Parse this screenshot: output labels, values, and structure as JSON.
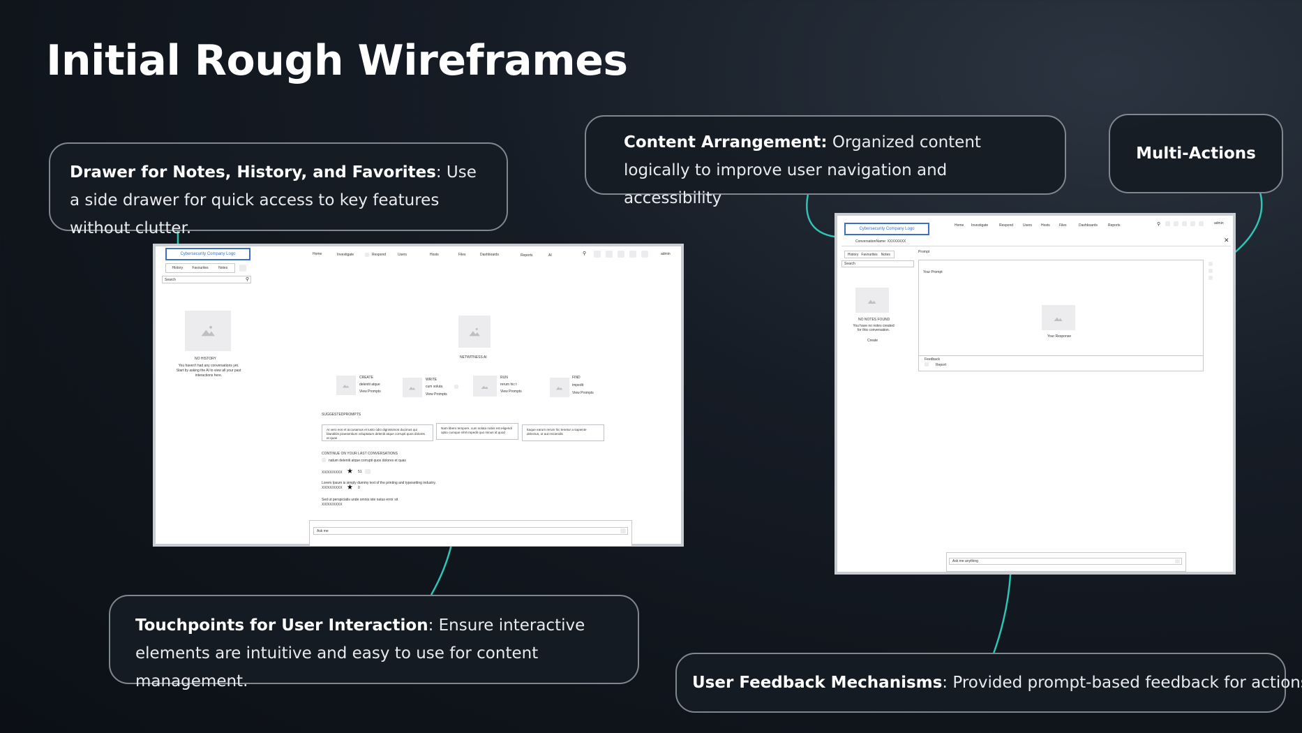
{
  "title": "Initial Rough Wireframes",
  "callouts": {
    "drawer": {
      "bold": "Drawer for Notes, History, and Favorites",
      "text": ": Use a side drawer for quick access to key features without clutter."
    },
    "content": {
      "bold": "Content Arrangement:",
      "text": " Organized content logically to improve user navigation and accessibility"
    },
    "multi": {
      "bold": "Multi-Actions"
    },
    "touch": {
      "bold": "Touchpoints for User Interaction",
      "text": ": Ensure interactive elements are intuitive and easy to use for content management."
    },
    "feedback": {
      "bold": "User Feedback Mechanisms",
      "text": ": Provided prompt-based feedback for actions"
    }
  },
  "colors": {
    "connector": "#2ec4b6",
    "callout_border": "#7f8791",
    "logo_blue": "#3c6fc4"
  },
  "wf1": {
    "logo": "Cybersecurity Company Logo",
    "tabs": [
      "History",
      "Favourites",
      "Notes"
    ],
    "search_placeholder": "Search",
    "nav": [
      "Home",
      "Investigate",
      "Respond",
      "Users",
      "Hosts",
      "Files",
      "Dashboards",
      "Reports",
      "AI"
    ],
    "user": "admin",
    "no_history_title": "NO HISTORY",
    "no_history_text": "You haven't had any conversations yet. Start by asking the AI to view all your past interactions here.",
    "ai_title": "NETWITNESS AI",
    "features": [
      {
        "title": "CREATE",
        "sub": "deleniti atque",
        "link": "View Prompts"
      },
      {
        "title": "WRITE",
        "sub": "cum soluta",
        "link": "View Prompts"
      },
      {
        "title": "RUN",
        "sub": "rerum hic t",
        "link": "View Prompts"
      },
      {
        "title": "FIND",
        "sub": "impedit",
        "link": "View Prompts"
      }
    ],
    "suggested_label": "SUGGESTEDPROMPTS",
    "suggested": [
      "At vero eos et accusamus et iusto odio dignissimos ducimus qui blanditiis praesentium voluptatum deleniti atque corrupti quos dolores et quas",
      "Nam libero tempore, cum soluta nobis est eligendi optio cumque nihil impedit quo minus id quod",
      "Itaque earum rerum hic tenetur a sapiente delectus, ut aut reiciendis"
    ],
    "continue_label": "CONTINUE ON YOUR LAST CONVERSATIONS",
    "conv_snippet": "natum deleniti atque corrupti quos dolores et quas",
    "conv_date1": "XX/XX/XXXX",
    "conv_count1": "51",
    "conv_text2": "Lorem Ipsum is simply dummy text of the printing and typesetting industry.",
    "conv_date2": "XX/XX/XXXX",
    "conv_count2": "0",
    "conv_text3": "Sed ut perspiciatis unde omnis iste natus error sit",
    "conv_date3": "XX/XX/XXXX",
    "ask_placeholder": "Ask me"
  },
  "wf2": {
    "logo": "Cybersecurity Company Logo",
    "nav": [
      "Home",
      "Investigate",
      "Respond",
      "Users",
      "Hosts",
      "Files",
      "Dashboards",
      "Reports"
    ],
    "user": "admin",
    "conversation_name": "ConversationName: XXXXXXXX",
    "tabs": [
      "History",
      "Favourites",
      "Notes"
    ],
    "search_placeholder": "Search",
    "no_notes_title": "NO NOTES FOUND",
    "no_notes_text": "You have no notes created for this conversation.",
    "create_link": "Create",
    "prompt_label": "Prompt",
    "your_prompt": "Your Prompt",
    "your_response": "Your Response",
    "feedback_label": "Feedback",
    "report_label": "Report",
    "ask_placeholder": "Ask me anything"
  }
}
